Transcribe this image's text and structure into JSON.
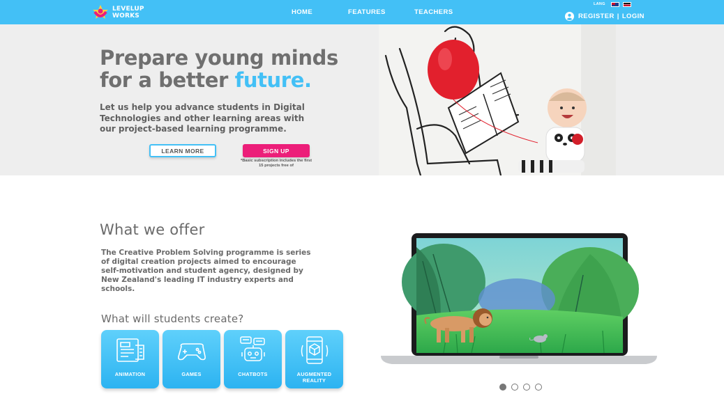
{
  "header": {
    "logo_line1": "LEVELUP",
    "logo_line2": "WORKS",
    "nav": {
      "home": "HOME",
      "features": "FEATURES",
      "teachers": "TEACHERS"
    },
    "lang_label": "LANG",
    "register": "REGISTER",
    "separator": "|",
    "login": "LOGIN",
    "icons": {
      "user": "user-circle-icon",
      "nz_flag": "nz-flag-icon",
      "maori_flag": "maori-flag-icon"
    },
    "background_color": "#43c0f6"
  },
  "hero": {
    "title_line1": "Prepare young minds",
    "title_line2_prefix": "for a better ",
    "title_accent": "future.",
    "subtitle": "Let us help you advance students in Digital Technologies and other learning areas with our project-based learning programme.",
    "learn_more": "LEARN MORE",
    "sign_up": "SIGN UP",
    "signup_note": "*Basic subscription includes the first 15 projects free of",
    "accent_color": "#43c0f6",
    "signup_color": "#ec1e79"
  },
  "offer": {
    "title": "What we offer",
    "text": "The Creative Problem Solving programme is series of digital creation projects aimed to encourage self-motivation and student agency, designed by New Zealand's leading IT industry experts and schools.",
    "create_title": "What will students create?",
    "cards": [
      {
        "label": "ANIMATION",
        "icon": "animation-icon"
      },
      {
        "label": "GAMES",
        "icon": "gamepad-icon"
      },
      {
        "label": "CHATBOTS",
        "icon": "chatbot-icon"
      },
      {
        "label": "AUGMENTED REALITY",
        "icon": "ar-phone-icon"
      }
    ]
  },
  "carousel": {
    "slides": 4,
    "active": 1
  }
}
